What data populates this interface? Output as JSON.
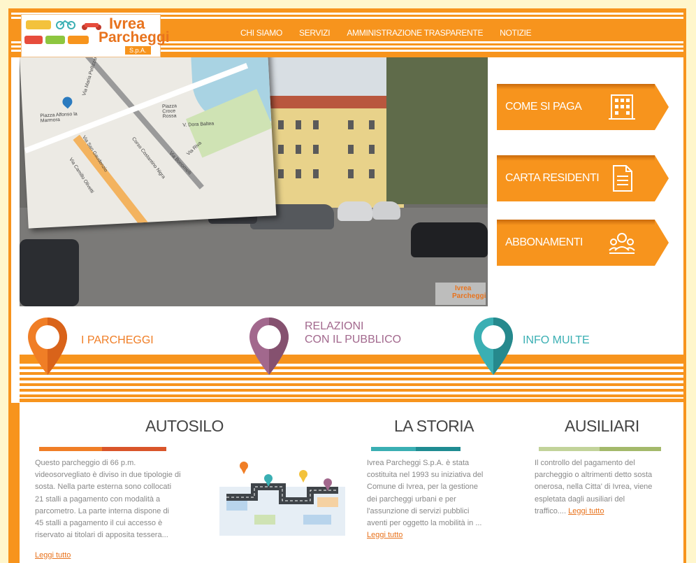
{
  "logo": {
    "title": "Ivrea",
    "subtitle": "Parcheggi",
    "suffix": "S.p.A."
  },
  "nav": {
    "items": [
      "CHI SIAMO",
      "SERVIZI",
      "AMMINISTRAZIONE TRASPARENTE",
      "NOTIZIE"
    ]
  },
  "map": {
    "labels": [
      "Piazza Alfonso la Marmora",
      "Piazza Croce Rossa",
      "V. Dora Baltea",
      "Via Maria Pellizzari",
      "Corso Costantino Nigra",
      "Via Riva",
      "Via San Gaudenzio",
      "Via Camillo Olivetti",
      "Via Bonomelli"
    ]
  },
  "hero": {
    "watermark_title": "Ivrea",
    "watermark_sub": "Parcheggi"
  },
  "cta": [
    {
      "label": "COME SI PAGA",
      "icon": "building-icon"
    },
    {
      "label": "CARTA RESIDENTI",
      "icon": "document-icon"
    },
    {
      "label": "ABBONAMENTI",
      "icon": "users-icon"
    }
  ],
  "categories": [
    {
      "label": "I PARCHEGGI",
      "color": "#f07e26"
    },
    {
      "label_line1": "RELAZIONI",
      "label_line2": "CON IL PUBBLICO",
      "color": "#a2688d"
    },
    {
      "label": "INFO MULTE",
      "color": "#3aafb3"
    }
  ],
  "sections": {
    "autosilo": {
      "title": "AUTOSILO",
      "lines": [
        "Questo parcheggio di 66  p.m.",
        "videosorvegliato è diviso in due tipologie di",
        "sosta. Nella parte esterna sono collocati",
        "21 stalli  a pagamento con modalità a",
        "parcometro. La parte interna dispone di",
        "45 stalli a pagamento il cui accesso è",
        "riservato ai titolari di apposita tessera..."
      ],
      "read_more": "Leggi tutto",
      "colors": [
        "#f07e26",
        "#d9552a"
      ]
    },
    "storia": {
      "title": "LA STORIA",
      "lines": [
        "Ivrea Parcheggi S.p.A. è stata",
        "costituita nel 1993 su iniziativa del",
        "Comune di Ivrea, per la gestione",
        "dei parcheggi urbani e per",
        "l'assunzione di servizi pubblici",
        "aventi per oggetto la mobilità in ..."
      ],
      "read_more": "Leggi tutto",
      "colors": [
        "#3aafb3",
        "#1f8c92"
      ]
    },
    "ausiliari": {
      "title": "AUSILIARI",
      "lines": [
        "Il controllo del pagamento del",
        "parcheggio o altrimenti detto sosta",
        "onerosa, nella Citta' di Ivrea, viene",
        "espletata dagli ausiliari del",
        "traffico...."
      ],
      "read_more": "Leggi tutto",
      "colors": [
        "#c2d39a",
        "#a4b96b"
      ]
    }
  }
}
